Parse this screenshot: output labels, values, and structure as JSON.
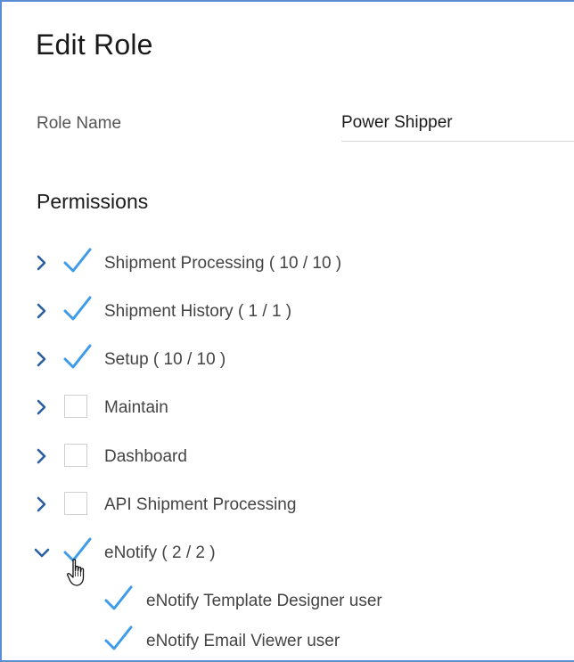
{
  "page": {
    "title": "Edit Role"
  },
  "role": {
    "label": "Role Name",
    "value": "Power Shipper"
  },
  "permissions": {
    "heading": "Permissions",
    "items": [
      {
        "label": "Shipment Processing ( 10 / 10 )",
        "checked": true,
        "expanded": false
      },
      {
        "label": "Shipment History ( 1 / 1 )",
        "checked": true,
        "expanded": false
      },
      {
        "label": "Setup ( 10 / 10 )",
        "checked": true,
        "expanded": false
      },
      {
        "label": "Maintain",
        "checked": false,
        "expanded": false
      },
      {
        "label": "Dashboard",
        "checked": false,
        "expanded": false
      },
      {
        "label": "API Shipment Processing",
        "checked": false,
        "expanded": false
      },
      {
        "label": "eNotify ( 2 / 2 )",
        "checked": true,
        "expanded": true,
        "children": [
          {
            "label": "eNotify Template Designer user",
            "checked": true
          },
          {
            "label": "eNotify Email Viewer user",
            "checked": true
          }
        ]
      }
    ]
  },
  "colors": {
    "check": "#3d9be9",
    "chevron": "#2b5f9e",
    "frame_border": "#5b8dd6"
  },
  "icons": {
    "chevron_right": "chevron-right-icon",
    "chevron_down": "chevron-down-icon",
    "check": "check-icon",
    "cursor": "hand-pointer-icon"
  }
}
